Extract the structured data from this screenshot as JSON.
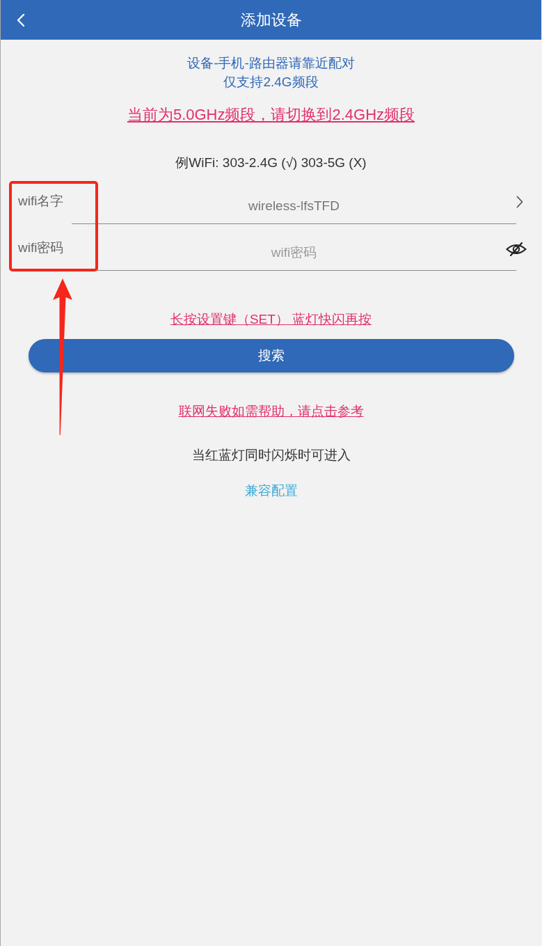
{
  "header": {
    "title": "添加设备"
  },
  "notice": [
    "设备-手机-路由器请靠近配对",
    "仅支持2.4G频段"
  ],
  "band_warning": "当前为5.0GHz频段，请切换到2.4GHz频段",
  "example": "例WiFi: 303-2.4G (√) 303-5G (X)",
  "fields": [
    {
      "kind": "select",
      "label": "wifi名字",
      "value": "wireless-lfsTFD"
    },
    {
      "kind": "password",
      "label": "wifi密码",
      "placeholder": "wifi密码",
      "revealed": false
    }
  ],
  "set_key_hint": "长按设置键（SET） 蓝灯快闪再按",
  "search_button": "搜索",
  "help_link": "联网失败如需帮助，请点击参考",
  "compat_note": "当红蓝灯同时闪烁时可进入",
  "compat_link": "兼容配置"
}
